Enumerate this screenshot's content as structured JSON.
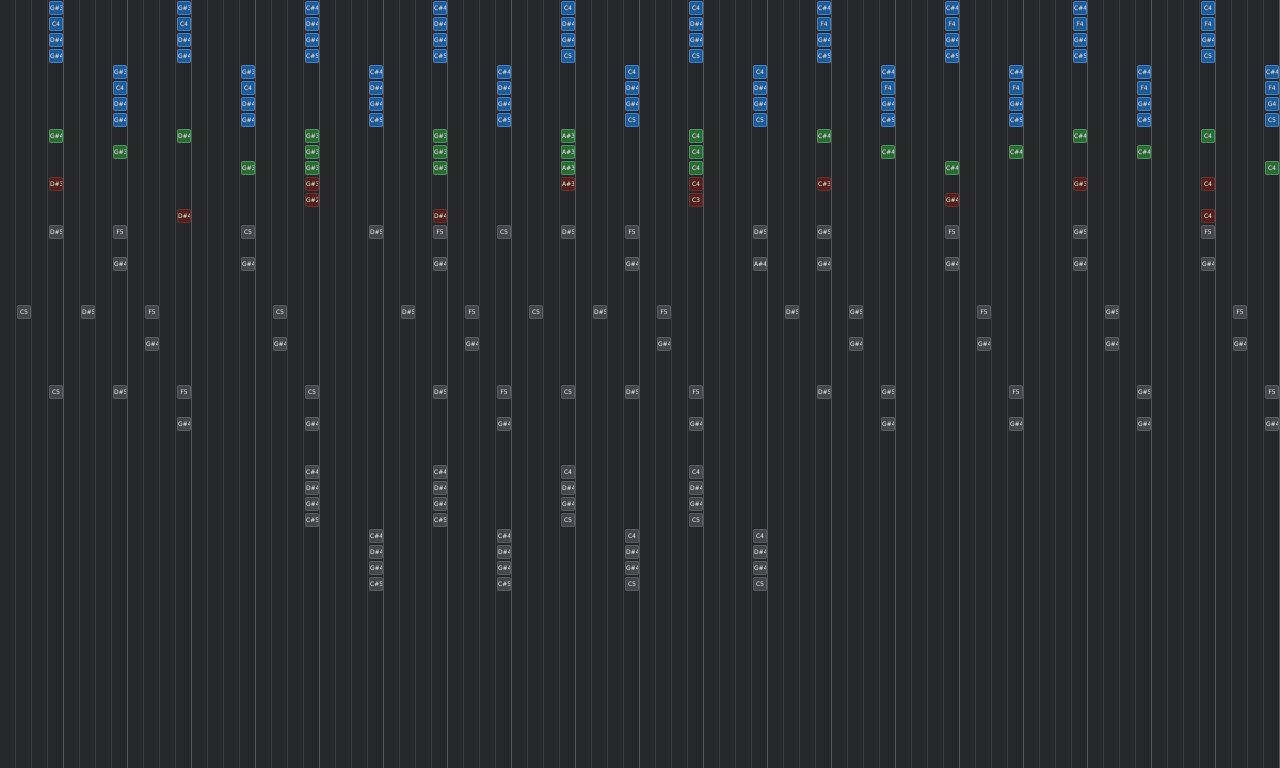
{
  "colors": {
    "background": "#26272a",
    "beat_line": "#3a3b3f",
    "bar_line": "#56575c",
    "blue": "#1e5b96",
    "green": "#2b6a34",
    "red": "#52211e",
    "gray": "#45464b"
  },
  "tracks": [
    {
      "color": "blue",
      "columns": [
        {
          "col": 3,
          "rows": [
            0,
            1,
            2,
            3
          ],
          "labels": [
            "G#3",
            "C4",
            "D#4",
            "G#4"
          ]
        },
        {
          "col": 11,
          "rows": [
            0,
            1,
            2,
            3
          ],
          "labels": [
            "G#3",
            "C4",
            "D#4",
            "G#4"
          ]
        },
        {
          "col": 19,
          "rows": [
            0,
            1,
            2,
            3
          ],
          "labels": [
            "C#4",
            "D#4",
            "G#4",
            "C#5"
          ]
        },
        {
          "col": 27,
          "rows": [
            0,
            1,
            2,
            3
          ],
          "labels": [
            "C#4",
            "D#4",
            "G#4",
            "C#5"
          ]
        },
        {
          "col": 35,
          "rows": [
            0,
            1,
            2,
            3
          ],
          "labels": [
            "C4",
            "D#4",
            "G#4",
            "C5"
          ]
        },
        {
          "col": 43,
          "rows": [
            0,
            1,
            2,
            3
          ],
          "labels": [
            "C4",
            "D#4",
            "G#4",
            "C5"
          ]
        },
        {
          "col": 51,
          "rows": [
            0,
            1,
            2,
            3
          ],
          "labels": [
            "C#4",
            "F4",
            "G#4",
            "C#5"
          ]
        },
        {
          "col": 59,
          "rows": [
            0,
            1,
            2,
            3
          ],
          "labels": [
            "C#4",
            "F4",
            "G#4",
            "C#5"
          ]
        },
        {
          "col": 67,
          "rows": [
            0,
            1,
            2,
            3
          ],
          "labels": [
            "C#4",
            "F4",
            "G#4",
            "C#5"
          ]
        },
        {
          "col": 75,
          "rows": [
            0,
            1,
            2,
            3
          ],
          "labels": [
            "C4",
            "F4",
            "G#4",
            "C5"
          ]
        },
        {
          "col": 7,
          "rows": [
            4,
            5,
            6,
            7
          ],
          "labels": [
            "G#3",
            "C4",
            "D#4",
            "G#4"
          ]
        },
        {
          "col": 15,
          "rows": [
            4,
            5,
            6,
            7
          ],
          "labels": [
            "G#3",
            "C4",
            "D#4",
            "G#4"
          ]
        },
        {
          "col": 23,
          "rows": [
            4,
            5,
            6,
            7
          ],
          "labels": [
            "C#4",
            "D#4",
            "G#4",
            "C#5"
          ]
        },
        {
          "col": 31,
          "rows": [
            4,
            5,
            6,
            7
          ],
          "labels": [
            "C#4",
            "D#4",
            "G#4",
            "C#5"
          ]
        },
        {
          "col": 39,
          "rows": [
            4,
            5,
            6,
            7
          ],
          "labels": [
            "C4",
            "D#4",
            "G#4",
            "C5"
          ]
        },
        {
          "col": 47,
          "rows": [
            4,
            5,
            6,
            7
          ],
          "labels": [
            "C4",
            "D#4",
            "G#4",
            "C5"
          ]
        },
        {
          "col": 55,
          "rows": [
            4,
            5,
            6,
            7
          ],
          "labels": [
            "C#4",
            "F4",
            "G#4",
            "C#5"
          ]
        },
        {
          "col": 63,
          "rows": [
            4,
            5,
            6,
            7
          ],
          "labels": [
            "C#4",
            "F4",
            "G#4",
            "C#5"
          ]
        },
        {
          "col": 71,
          "rows": [
            4,
            5,
            6,
            7
          ],
          "labels": [
            "C#4",
            "F4",
            "G#4",
            "C#5"
          ]
        },
        {
          "col": 79,
          "rows": [
            4,
            5,
            6,
            7
          ],
          "labels": [
            "C#4",
            "F4",
            "G4",
            "C5"
          ]
        }
      ]
    },
    {
      "color": "green",
      "columns": [
        {
          "col": 3,
          "rows": [
            8
          ],
          "labels": [
            "G#4"
          ]
        },
        {
          "col": 7,
          "rows": [
            9
          ],
          "labels": [
            "G#3"
          ]
        },
        {
          "col": 11,
          "rows": [
            8
          ],
          "labels": [
            "D#4"
          ]
        },
        {
          "col": 15,
          "rows": [
            10
          ],
          "labels": [
            "G#3"
          ]
        },
        {
          "col": 19,
          "rows": [
            8,
            9,
            10
          ],
          "labels": [
            "G#3",
            "G#3",
            "G#3"
          ]
        },
        {
          "col": 27,
          "rows": [
            8,
            9,
            10
          ],
          "labels": [
            "G#3",
            "G#3",
            "G#3"
          ]
        },
        {
          "col": 35,
          "rows": [
            8,
            9,
            10
          ],
          "labels": [
            "A#3",
            "A#3",
            "A#3"
          ]
        },
        {
          "col": 43,
          "rows": [
            8,
            9,
            10
          ],
          "labels": [
            "C4",
            "C4",
            "C4"
          ]
        },
        {
          "col": 51,
          "rows": [
            8
          ],
          "labels": [
            "C#4"
          ]
        },
        {
          "col": 55,
          "rows": [
            9
          ],
          "labels": [
            "C#4"
          ]
        },
        {
          "col": 59,
          "rows": [
            10
          ],
          "labels": [
            "C#4"
          ]
        },
        {
          "col": 63,
          "rows": [
            9
          ],
          "labels": [
            "C#4"
          ]
        },
        {
          "col": 67,
          "rows": [
            8
          ],
          "labels": [
            "C#4"
          ]
        },
        {
          "col": 71,
          "rows": [
            9
          ],
          "labels": [
            "C#4"
          ]
        },
        {
          "col": 75,
          "rows": [
            8
          ],
          "labels": [
            "C4"
          ]
        },
        {
          "col": 79,
          "rows": [
            10
          ],
          "labels": [
            "C4"
          ]
        }
      ]
    },
    {
      "color": "red",
      "columns": [
        {
          "col": 3,
          "rows": [
            11
          ],
          "labels": [
            "D#3"
          ]
        },
        {
          "col": 11,
          "rows": [
            13
          ],
          "labels": [
            "D#4"
          ]
        },
        {
          "col": 19,
          "rows": [
            11,
            12
          ],
          "labels": [
            "G#3",
            "G#2"
          ]
        },
        {
          "col": 27,
          "rows": [
            13
          ],
          "labels": [
            "D#4"
          ]
        },
        {
          "col": 35,
          "rows": [
            11
          ],
          "labels": [
            "A#3"
          ]
        },
        {
          "col": 43,
          "rows": [
            11,
            12
          ],
          "labels": [
            "C4",
            "C3"
          ]
        },
        {
          "col": 51,
          "rows": [
            11
          ],
          "labels": [
            "C#3"
          ]
        },
        {
          "col": 59,
          "rows": [
            12
          ],
          "labels": [
            "G#4"
          ]
        },
        {
          "col": 67,
          "rows": [
            11
          ],
          "labels": [
            "G#3"
          ]
        },
        {
          "col": 75,
          "rows": [
            11,
            13
          ],
          "labels": [
            "C4",
            "C4"
          ]
        }
      ]
    },
    {
      "color": "gray",
      "columns": [
        {
          "col": 3,
          "rows": [
            14
          ],
          "labels": [
            "D#5"
          ]
        },
        {
          "col": 7,
          "rows": [
            14,
            16
          ],
          "labels": [
            "F5",
            "G#4"
          ]
        },
        {
          "col": 15,
          "rows": [
            14,
            16
          ],
          "labels": [
            "C5",
            "G#4"
          ]
        },
        {
          "col": 23,
          "rows": [
            14
          ],
          "labels": [
            "D#5"
          ]
        },
        {
          "col": 27,
          "rows": [
            14,
            16
          ],
          "labels": [
            "F5",
            "G#4"
          ]
        },
        {
          "col": 31,
          "rows": [
            14
          ],
          "labels": [
            "C5"
          ]
        },
        {
          "col": 35,
          "rows": [
            14
          ],
          "labels": [
            "D#5"
          ]
        },
        {
          "col": 39,
          "rows": [
            14,
            16
          ],
          "labels": [
            "F5",
            "G#4"
          ]
        },
        {
          "col": 47,
          "rows": [
            14,
            16
          ],
          "labels": [
            "D#5",
            "A#4"
          ]
        },
        {
          "col": 51,
          "rows": [
            14,
            16
          ],
          "labels": [
            "G#5",
            "G#4"
          ]
        },
        {
          "col": 59,
          "rows": [
            14,
            16
          ],
          "labels": [
            "F5",
            "G#4"
          ]
        },
        {
          "col": 67,
          "rows": [
            14,
            16
          ],
          "labels": [
            "G#5",
            "G#4"
          ]
        },
        {
          "col": 75,
          "rows": [
            14,
            16
          ],
          "labels": [
            "F5",
            "G#4"
          ]
        },
        {
          "col": 1,
          "rows": [
            19
          ],
          "labels": [
            "C5"
          ]
        },
        {
          "col": 5,
          "rows": [
            19
          ],
          "labels": [
            "D#5"
          ]
        },
        {
          "col": 9,
          "rows": [
            19,
            21
          ],
          "labels": [
            "F5",
            "G#4"
          ]
        },
        {
          "col": 17,
          "rows": [
            19,
            21
          ],
          "labels": [
            "C5",
            "G#4"
          ]
        },
        {
          "col": 25,
          "rows": [
            19
          ],
          "labels": [
            "D#5"
          ]
        },
        {
          "col": 29,
          "rows": [
            19,
            21
          ],
          "labels": [
            "F5",
            "G#4"
          ]
        },
        {
          "col": 33,
          "rows": [
            19
          ],
          "labels": [
            "C5"
          ]
        },
        {
          "col": 37,
          "rows": [
            19
          ],
          "labels": [
            "D#5"
          ]
        },
        {
          "col": 41,
          "rows": [
            19,
            21
          ],
          "labels": [
            "F5",
            "G#4"
          ]
        },
        {
          "col": 49,
          "rows": [
            19
          ],
          "labels": [
            "D#5"
          ]
        },
        {
          "col": 53,
          "rows": [
            19,
            21
          ],
          "labels": [
            "G#5",
            "G#4"
          ]
        },
        {
          "col": 61,
          "rows": [
            19,
            21
          ],
          "labels": [
            "F5",
            "G#4"
          ]
        },
        {
          "col": 69,
          "rows": [
            19,
            21
          ],
          "labels": [
            "G#5",
            "G#4"
          ]
        },
        {
          "col": 77,
          "rows": [
            19,
            21
          ],
          "labels": [
            "F5",
            "G#4"
          ]
        },
        {
          "col": 3,
          "rows": [
            24
          ],
          "labels": [
            "C5"
          ]
        },
        {
          "col": 7,
          "rows": [
            24
          ],
          "labels": [
            "D#5"
          ]
        },
        {
          "col": 11,
          "rows": [
            24,
            26
          ],
          "labels": [
            "F5",
            "G#4"
          ]
        },
        {
          "col": 19,
          "rows": [
            24,
            26
          ],
          "labels": [
            "C5",
            "G#4"
          ]
        },
        {
          "col": 27,
          "rows": [
            24
          ],
          "labels": [
            "D#5"
          ]
        },
        {
          "col": 31,
          "rows": [
            24,
            26
          ],
          "labels": [
            "F5",
            "G#4"
          ]
        },
        {
          "col": 35,
          "rows": [
            24
          ],
          "labels": [
            "C5"
          ]
        },
        {
          "col": 39,
          "rows": [
            24
          ],
          "labels": [
            "D#5"
          ]
        },
        {
          "col": 43,
          "rows": [
            24,
            26
          ],
          "labels": [
            "F5",
            "G#4"
          ]
        },
        {
          "col": 51,
          "rows": [
            24
          ],
          "labels": [
            "D#5"
          ]
        },
        {
          "col": 55,
          "rows": [
            24,
            26
          ],
          "labels": [
            "G#5",
            "G#4"
          ]
        },
        {
          "col": 63,
          "rows": [
            24,
            26
          ],
          "labels": [
            "F5",
            "G#4"
          ]
        },
        {
          "col": 71,
          "rows": [
            24,
            26
          ],
          "labels": [
            "G#5",
            "G#4"
          ]
        },
        {
          "col": 79,
          "rows": [
            24,
            26
          ],
          "labels": [
            "F5",
            "G#4"
          ]
        },
        {
          "col": 19,
          "rows": [
            29,
            30,
            31,
            32
          ],
          "labels": [
            "C#4",
            "D#4",
            "G#4",
            "C#5"
          ]
        },
        {
          "col": 27,
          "rows": [
            29,
            30,
            31,
            32
          ],
          "labels": [
            "C#4",
            "D#4",
            "G#4",
            "C#5"
          ]
        },
        {
          "col": 35,
          "rows": [
            29,
            30,
            31,
            32
          ],
          "labels": [
            "C4",
            "D#4",
            "G#4",
            "C5"
          ]
        },
        {
          "col": 43,
          "rows": [
            29,
            30,
            31,
            32
          ],
          "labels": [
            "C4",
            "D#4",
            "G#4",
            "C5"
          ]
        },
        {
          "col": 23,
          "rows": [
            33,
            34,
            35,
            36
          ],
          "labels": [
            "C#4",
            "D#4",
            "G#4",
            "C#5"
          ]
        },
        {
          "col": 31,
          "rows": [
            33,
            34,
            35,
            36
          ],
          "labels": [
            "C#4",
            "D#4",
            "G#4",
            "C#5"
          ]
        },
        {
          "col": 39,
          "rows": [
            33,
            34,
            35,
            36
          ],
          "labels": [
            "C4",
            "D#4",
            "G#4",
            "C5"
          ]
        },
        {
          "col": 47,
          "rows": [
            33,
            34,
            35,
            36
          ],
          "labels": [
            "C4",
            "D#4",
            "G#4",
            "C5"
          ]
        }
      ]
    }
  ]
}
